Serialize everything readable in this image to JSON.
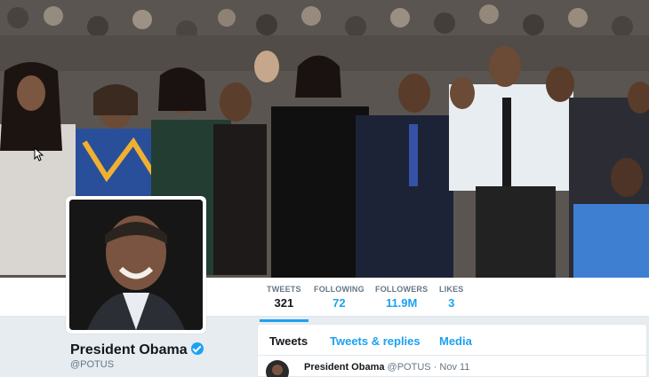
{
  "profile": {
    "name": "President Obama",
    "handle": "@POTUS",
    "verified": true
  },
  "stats": [
    {
      "label": "TWEETS",
      "value": "321",
      "active": true
    },
    {
      "label": "FOLLOWING",
      "value": "72",
      "active": false
    },
    {
      "label": "FOLLOWERS",
      "value": "11.9M",
      "active": false
    },
    {
      "label": "LIKES",
      "value": "3",
      "active": false
    }
  ],
  "timeline": {
    "tabs": [
      {
        "label": "Tweets",
        "active": true
      },
      {
        "label": "Tweets & replies",
        "active": false
      },
      {
        "label": "Media",
        "active": false
      }
    ],
    "first_tweet": {
      "name": "President Obama",
      "handle": "@POTUS",
      "date": "· Nov 11"
    }
  },
  "colors": {
    "accent": "#1da1f2",
    "background": "#e6ecf0",
    "text": "#14171a",
    "muted": "#657786"
  },
  "icons": {
    "verified": "verified-badge-icon",
    "cursor": "mouse-pointer-icon"
  }
}
